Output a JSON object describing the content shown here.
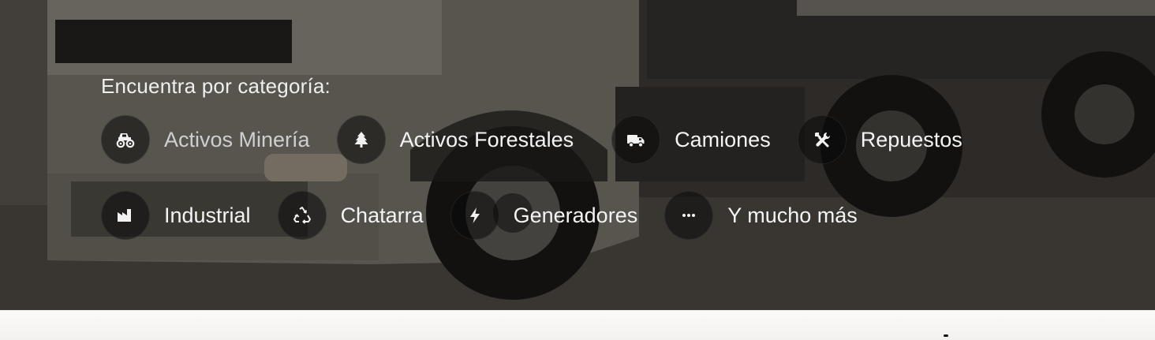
{
  "hero": {
    "heading": "Encuentra por categoría:",
    "categories_row1": [
      {
        "label": "Activos Minería",
        "icon": "monster-truck-icon"
      },
      {
        "label": "Activos Forestales",
        "icon": "tree-icon"
      },
      {
        "label": "Camiones",
        "icon": "truck-icon"
      },
      {
        "label": "Repuestos",
        "icon": "tools-icon"
      }
    ],
    "categories_row2": [
      {
        "label": "Industrial",
        "icon": "factory-icon"
      },
      {
        "label": "Chatarra",
        "icon": "recycle-icon"
      },
      {
        "label": "Generadores",
        "icon": "lightning-bolt-icon"
      },
      {
        "label": "Y mucho más",
        "icon": "ellipsis-icon"
      }
    ]
  },
  "colors": {
    "text": "#f4f4f4",
    "circle": "#1a1a1a"
  }
}
